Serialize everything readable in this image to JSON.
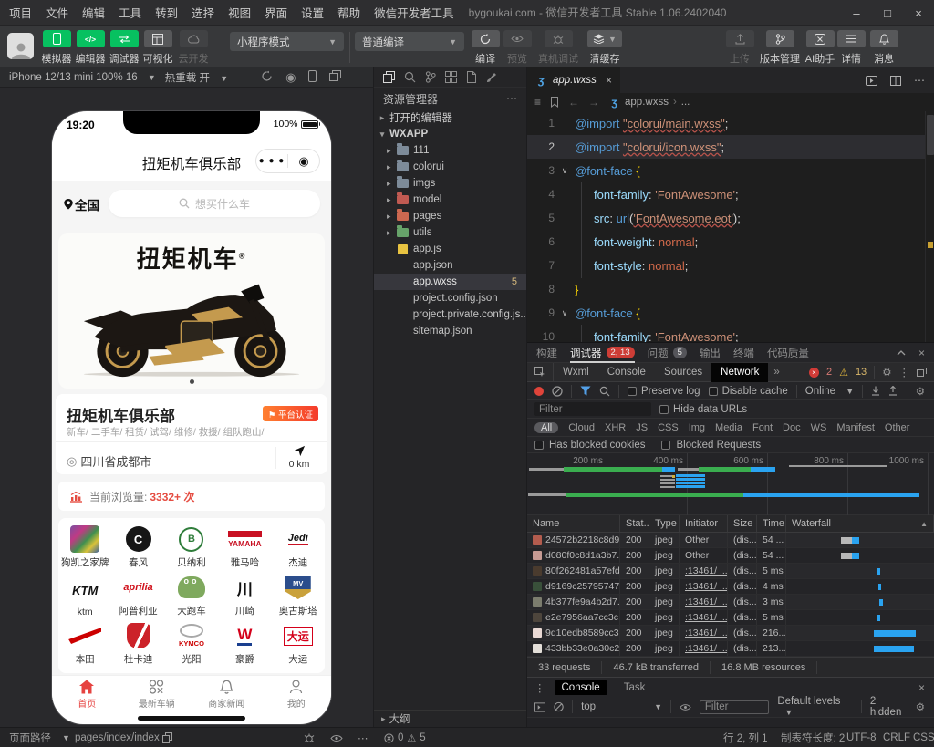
{
  "titlebar": {
    "menus": [
      "项目",
      "文件",
      "编辑",
      "工具",
      "转到",
      "选择",
      "视图",
      "界面",
      "设置",
      "帮助",
      "微信开发者工具"
    ],
    "title": "bygoukai.com - 微信开发者工具 Stable 1.06.2402040",
    "minimize": "–",
    "maximize": "□",
    "close": "×"
  },
  "toolbar": {
    "mode_buttons": [
      {
        "label": "模拟器"
      },
      {
        "label": "编辑器"
      },
      {
        "label": "调试器"
      },
      {
        "label": "可视化"
      },
      {
        "label": "云开发"
      }
    ],
    "mode_select": "小程序模式",
    "compile_select": "普通编译",
    "actions": [
      {
        "label": "编译"
      },
      {
        "label": "预览"
      },
      {
        "label": "真机调试"
      },
      {
        "label": "清缓存"
      }
    ],
    "right_buttons": [
      {
        "label": "上传"
      },
      {
        "label": "版本管理"
      },
      {
        "label": "AI助手"
      },
      {
        "label": "详情"
      },
      {
        "label": "消息"
      }
    ]
  },
  "simbar": {
    "device": "iPhone 12/13 mini 100% 16",
    "hot_reload": "热重载 开"
  },
  "phone": {
    "time": "19:20",
    "battery": "100%",
    "nav_title": "扭矩机车俱乐部",
    "location": "全国",
    "search_placeholder": "想买什么车",
    "banner_title": "扭矩机车",
    "club": {
      "name": "扭矩机车俱乐部",
      "badge": "⚑ 平台认证",
      "services": "新车/ 二手车/ 租赁/ 试驾/ 维修/ 救援/ 组队跑山/",
      "address": "四川省成都市",
      "distance": "0 km"
    },
    "views_label": "当前浏览量:",
    "views_value": "3332+ 次",
    "brands": [
      {
        "n": "狗凯之家牌",
        "lc": "b-art",
        "g": ""
      },
      {
        "n": "春风",
        "lc": "b-cf",
        "g": "C"
      },
      {
        "n": "贝纳利",
        "lc": "b-benelli",
        "g": "B"
      },
      {
        "n": "雅马哈",
        "lc": "b-yamaha",
        "g": "YAMAHA"
      },
      {
        "n": "杰迪",
        "lc": "b-jedi",
        "g": "Jedi"
      },
      {
        "n": "ktm",
        "lc": "b-ktm",
        "g": "KTM"
      },
      {
        "n": "阿普利亚",
        "lc": "b-aprilia",
        "g": "aprilia"
      },
      {
        "n": "大跑车",
        "lc": "b-frog",
        "g": "oo"
      },
      {
        "n": "川崎",
        "lc": "b-kawasaki",
        "g": "川"
      },
      {
        "n": "奥古斯塔",
        "lc": "b-mv",
        "g": "MV"
      },
      {
        "n": "本田",
        "lc": "b-honda",
        "g": ""
      },
      {
        "n": "杜卡迪",
        "lc": "b-ducati",
        "g": ""
      },
      {
        "n": "光阳",
        "lc": "b-kymco",
        "g": "KYMCO"
      },
      {
        "n": "豪爵",
        "lc": "b-haojue",
        "g": "W"
      },
      {
        "n": "大运",
        "lc": "b-dayun",
        "g": "大运"
      }
    ],
    "tabbar": [
      {
        "label": "首页"
      },
      {
        "label": "最新车辆"
      },
      {
        "label": "商家新闻"
      },
      {
        "label": "我的"
      }
    ]
  },
  "explorer": {
    "title": "资源管理器",
    "more": "⋯",
    "sec_open": "打开的编辑器",
    "sec_root": "WXAPP",
    "tree": [
      {
        "a": "▸",
        "icon": "f f-blue",
        "label": "111"
      },
      {
        "a": "▸",
        "icon": "f f-blue",
        "label": "colorui"
      },
      {
        "a": "▸",
        "icon": "f f-blue",
        "label": "imgs"
      },
      {
        "a": "▸",
        "icon": "f f-red",
        "label": "model"
      },
      {
        "a": "▸",
        "icon": "f f-orange",
        "label": "pages"
      },
      {
        "a": "▸",
        "icon": "f f-green",
        "label": "utils"
      },
      {
        "a": "",
        "icon": "fi i-js",
        "label": "app.js"
      },
      {
        "a": "",
        "icon": "fi i-json",
        "label": "app.json"
      },
      {
        "a": "",
        "icon": "fi i-wxss",
        "label": "app.wxss",
        "badge": "5",
        "cls": "sel"
      },
      {
        "a": "",
        "icon": "fi i-json",
        "label": "project.config.json"
      },
      {
        "a": "",
        "icon": "fi i-json",
        "label": "project.private.config.js..."
      },
      {
        "a": "",
        "icon": "fi i-json",
        "label": "sitemap.json"
      }
    ],
    "js_glyph": "JS",
    "json_glyph": "{}",
    "wxss_glyph": "ʒ",
    "outline": "大纲"
  },
  "editor": {
    "tab": "app.wxss",
    "crumb_file": "app.wxss",
    "crumb_more": "...",
    "lines": [
      {
        "n": 1,
        "tokens": [
          [
            "@import",
            "kw"
          ],
          [
            " ",
            ""
          ],
          [
            "\"colorui/main.wxss\"",
            "str sq"
          ],
          [
            ";",
            "pn"
          ]
        ]
      },
      {
        "n": 2,
        "active": true,
        "tokens": [
          [
            "@import",
            "kw"
          ],
          [
            " ",
            ""
          ],
          [
            "\"colorui/icon.wxss\"",
            "str sq"
          ],
          [
            ";",
            "pn"
          ]
        ]
      },
      {
        "n": 3,
        "fold": true,
        "tokens": [
          [
            "@font-face",
            "kw"
          ],
          [
            " ",
            ""
          ],
          [
            "{",
            "br"
          ]
        ]
      },
      {
        "n": 4,
        "ind": 1,
        "tokens": [
          [
            "font-family",
            "prop"
          ],
          [
            ":",
            "pn"
          ],
          [
            " ",
            ""
          ],
          [
            "'FontAwesome'",
            "str"
          ],
          [
            ";",
            "pn"
          ]
        ]
      },
      {
        "n": 5,
        "ind": 1,
        "tokens": [
          [
            "src",
            "prop"
          ],
          [
            ":",
            "pn"
          ],
          [
            " ",
            ""
          ],
          [
            "url",
            "fn"
          ],
          [
            "(",
            "pn"
          ],
          [
            "'FontAwesome.eot'",
            "str sq"
          ],
          [
            ")",
            "pn"
          ],
          [
            ";",
            "pn"
          ]
        ]
      },
      {
        "n": 6,
        "ind": 1,
        "tokens": [
          [
            "font-weight",
            "prop"
          ],
          [
            ":",
            "pn"
          ],
          [
            " ",
            ""
          ],
          [
            "normal",
            "val"
          ],
          [
            ";",
            "pn"
          ]
        ]
      },
      {
        "n": 7,
        "ind": 1,
        "tokens": [
          [
            "font-style",
            "prop"
          ],
          [
            ":",
            "pn"
          ],
          [
            " ",
            ""
          ],
          [
            "normal",
            "val"
          ],
          [
            ";",
            "pn"
          ]
        ]
      },
      {
        "n": 8,
        "tokens": [
          [
            "}",
            "br"
          ]
        ]
      },
      {
        "n": 9,
        "fold": true,
        "tokens": [
          [
            "@font-face",
            "kw"
          ],
          [
            " ",
            ""
          ],
          [
            "{",
            "br"
          ]
        ]
      },
      {
        "n": 10,
        "ind": 1,
        "tokens": [
          [
            "font-family",
            "prop"
          ],
          [
            ":",
            "pn"
          ],
          [
            " ",
            ""
          ],
          [
            "'FontAwesome'",
            "str"
          ],
          [
            ";",
            "pn"
          ]
        ]
      }
    ]
  },
  "debug": {
    "panel_tabs": [
      {
        "label": "构建"
      },
      {
        "label": "调试器",
        "badge": "2, 13",
        "bcls": "red",
        "cls": "active"
      },
      {
        "label": "问题",
        "badge": "5",
        "bcls": "gray"
      },
      {
        "label": "输出"
      },
      {
        "label": "终端"
      },
      {
        "label": "代码质量"
      }
    ],
    "devtabs": [
      {
        "label": "Wxml"
      },
      {
        "label": "Console"
      },
      {
        "label": "Sources"
      },
      {
        "label": "Network",
        "cls": "active"
      }
    ],
    "more": "»",
    "err_count": "2",
    "warn_count": "13",
    "network": {
      "preserve": "Preserve log",
      "cache": "Disable cache",
      "online": "Online",
      "filter_placeholder": "Filter",
      "hide_urls": "Hide data URLs",
      "pills": [
        {
          "label": "All",
          "cls": "active"
        },
        {
          "label": "Cloud"
        },
        {
          "label": "XHR"
        },
        {
          "label": "JS"
        },
        {
          "label": "CSS"
        },
        {
          "label": "Img"
        },
        {
          "label": "Media"
        },
        {
          "label": "Font"
        },
        {
          "label": "Doc"
        },
        {
          "label": "WS"
        },
        {
          "label": "Manifest"
        },
        {
          "label": "Other"
        }
      ],
      "blocked_cookies": "Has blocked cookies",
      "blocked_requests": "Blocked Requests",
      "ticks": [
        {
          "label": "200 ms"
        },
        {
          "label": "400 ms"
        },
        {
          "label": "600 ms"
        },
        {
          "label": "800 ms"
        },
        {
          "label": "1000 ms"
        }
      ],
      "timeline_bars": [
        {
          "c": "tl-gray",
          "s": "left:2px;top:4px;width:140px;height:3px"
        },
        {
          "c": "tl-green",
          "s": "left:40px;top:3px;width:108px;height:5px"
        },
        {
          "c": "tl-blue",
          "s": "left:148px;top:3px;width:14px;height:5px"
        },
        {
          "c": "tl-gray",
          "s": "left:165px;top:4px;width:26px;height:3px"
        },
        {
          "c": "tl-green",
          "s": "left:188px;top:3px;width:57px;height:5px"
        },
        {
          "c": "tl-blue",
          "s": "left:245px;top:3px;width:27px;height:5px"
        },
        {
          "c": "tl-gray",
          "s": "left:287px;top:1px;width:107px;height:2px"
        },
        {
          "c": "tl-gray",
          "s": "left:146px;top:12px;width:16px;height:2px"
        },
        {
          "c": "tl-gray",
          "s": "left:146px;top:16px;width:16px;height:2px"
        },
        {
          "c": "tl-gray",
          "s": "left:146px;top:20px;width:16px;height:2px"
        },
        {
          "c": "tl-gray",
          "s": "left:146px;top:24px;width:16px;height:2px"
        },
        {
          "c": "tl-yellow",
          "s": "left:159px;top:12px;width:3px;height:3px"
        },
        {
          "c": "tl-blue",
          "s": "left:163px;top:11px;width:32px;height:3px"
        },
        {
          "c": "tl-blue",
          "s": "left:163px;top:15px;width:32px;height:3px"
        },
        {
          "c": "tl-blue",
          "s": "left:163px;top:19px;width:32px;height:3px"
        },
        {
          "c": "tl-blue",
          "s": "left:163px;top:23px;width:32px;height:3px"
        },
        {
          "c": "tl-gray",
          "s": "left:1px;top:32px;width:42px;height:3px"
        },
        {
          "c": "tl-green",
          "s": "left:43px;top:31px;width:194px;height:5px"
        },
        {
          "c": "tl-blue",
          "s": "left:237px;top:31px;width:193px;height:5px"
        }
      ],
      "columns": {
        "name": "Name",
        "status": "Stat...",
        "type": "Type",
        "initiator": "Initiator",
        "size": "Size",
        "time": "Time",
        "waterfall": "Waterfall",
        "sort": "▲"
      },
      "rows": [
        {
          "name": "24572b2218c8d9...",
          "ts": "background:#b35c4e",
          "st": "200",
          "ty": "jpeg",
          "init": "Other",
          "icls": "",
          "size": "(dis...",
          "time": "54 ...",
          "wf1": "display:block;left:60px;width:12px",
          "wf2": "display:block;left:72px;width:8px"
        },
        {
          "name": "d080f0c8d1a3b7...",
          "ts": "background:#c79b94",
          "st": "200",
          "ty": "jpeg",
          "init": "Other",
          "icls": "",
          "size": "(dis...",
          "time": "54 ...",
          "wf1": "display:block;left:60px;width:12px",
          "wf2": "display:block;left:72px;width:8px"
        },
        {
          "name": "80f262481a57efd...",
          "ts": "background:#4a3b2e",
          "st": "200",
          "ty": "jpeg",
          "init": ":13461/ ...",
          "icls": "lnk",
          "size": "(dis...",
          "time": "5 ms",
          "wf2": "display:block;left:100px;width:3px"
        },
        {
          "name": "d9169c25795747...",
          "ts": "background:#39503a",
          "st": "200",
          "ty": "jpeg",
          "init": ":13461/ ...",
          "icls": "lnk",
          "size": "(dis...",
          "time": "4 ms",
          "wf2": "display:block;left:101px;width:3px"
        },
        {
          "name": "4b377fe9a4b2d7...",
          "ts": "background:#7c7d6e",
          "st": "200",
          "ty": "jpeg",
          "init": ":13461/ ...",
          "icls": "lnk",
          "size": "(dis...",
          "time": "3 ms",
          "wf2": "display:block;left:102px;width:4px"
        },
        {
          "name": "e2e7956aa7cc3c...",
          "ts": "background:#4d453c",
          "st": "200",
          "ty": "jpeg",
          "init": ":13461/ ...",
          "icls": "lnk",
          "size": "(dis...",
          "time": "5 ms",
          "wf2": "display:block;left:100px;width:3px"
        },
        {
          "name": "9d10edb8589cc3...",
          "ts": "background:#e9d9d4",
          "st": "200",
          "ty": "jpeg",
          "init": ":13461/ ...",
          "icls": "lnk",
          "size": "(dis...",
          "time": "216...",
          "wf2": "display:block;left:96px;width:46px"
        },
        {
          "name": "433bb33e0a30c2...",
          "ts": "background:#e3ded8",
          "st": "200",
          "ty": "jpeg",
          "init": ":13461/ ...",
          "icls": "lnk",
          "size": "(dis...",
          "time": "213...",
          "wf2": "display:block;left:96px;width:44px"
        }
      ],
      "footer": [
        {
          "label": "33 requests"
        },
        {
          "label": "46.7 kB transferred"
        },
        {
          "label": "16.8 MB resources"
        }
      ]
    },
    "console": {
      "tab1": "Console",
      "tab2": "Task",
      "context": "top",
      "filter": "Filter",
      "levels": "Default levels",
      "hidden": "2 hidden"
    }
  },
  "statusbar": {
    "path_label": "页面路径",
    "path": "pages/index/index",
    "errors": "0",
    "warnings": "5",
    "right": [
      {
        "label": "行 2, 列 1"
      },
      {
        "label": "制表符长度: 2"
      },
      {
        "label": "UTF-8"
      },
      {
        "label": "CRLF"
      },
      {
        "label": "CSS"
      }
    ]
  }
}
